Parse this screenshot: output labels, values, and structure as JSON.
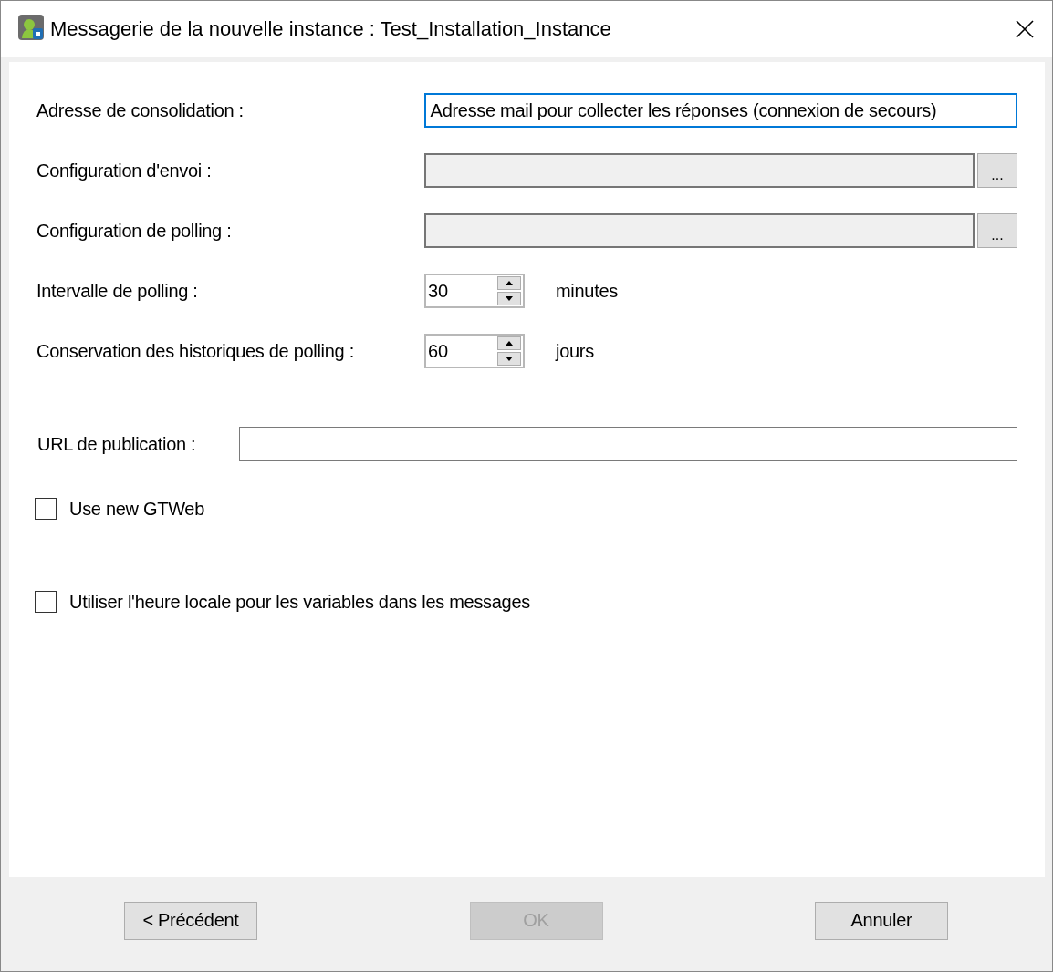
{
  "window": {
    "title": "Messagerie de la nouvelle instance : Test_Installation_Instance"
  },
  "fields": [
    {
      "kind": "text",
      "label": "Adresse de consolidation :",
      "value": "Adresse mail pour collecter les réponses (connexion de secours)",
      "focused": true
    },
    {
      "kind": "browse",
      "label": "Configuration d'envoi :",
      "button": "..."
    },
    {
      "kind": "browse",
      "label": "Configuration de polling :",
      "button": "..."
    },
    {
      "kind": "spinner",
      "label": "Intervalle de polling :",
      "value": "30",
      "unit": "minutes"
    },
    {
      "kind": "spinner",
      "label": "Conservation des historiques de polling :",
      "value": "60",
      "unit": "jours"
    }
  ],
  "url": {
    "label": "URL de publication :"
  },
  "checkboxes": [
    {
      "label": "Use new GTWeb",
      "checked": false
    },
    {
      "label": "Utiliser l'heure locale pour les variables dans les messages",
      "checked": false
    }
  ],
  "buttons": [
    {
      "label": "< Précédent",
      "disabled": false
    },
    {
      "label": "OK",
      "disabled": true
    },
    {
      "label": "Annuler",
      "disabled": false
    }
  ]
}
